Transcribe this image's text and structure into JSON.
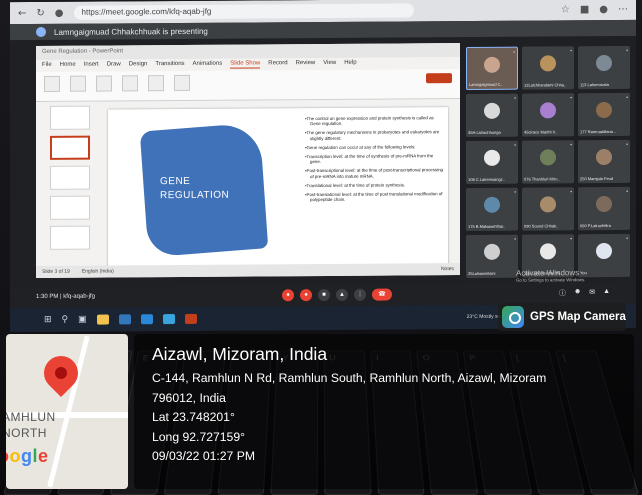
{
  "browser": {
    "url": "https://meet.google.com/kfq-aqab-jfg",
    "nav_icons": [
      "back-icon",
      "reload-icon",
      "lock-icon"
    ]
  },
  "meet": {
    "presenting_banner": "Lamngaigmuad Chhakchhuak is presenting",
    "meeting_info": "1:30 PM | kfq-aqab-jfg",
    "controls": [
      "mic-off-icon",
      "camera-off-icon",
      "captions-icon",
      "present-icon",
      "more-icon",
      "hang-up-icon"
    ],
    "participants": [
      {
        "name": "Lamngaigmuad C..",
        "speaker": true,
        "color": "#c9a48e"
      },
      {
        "name": "12Lalchhandami Chha..",
        "speaker": false,
        "color": "#b9925c"
      },
      {
        "name": "113 Lalremruata",
        "speaker": false,
        "color": "#7d8a96"
      },
      {
        "name": "35H.Lalrachhunga",
        "speaker": false,
        "color": "#d9d9d9"
      },
      {
        "name": "45Grace Marthi V..",
        "speaker": false,
        "color": "#a97fd0"
      },
      {
        "name": "177 Ramruatdiana ..",
        "speaker": false,
        "color": "#8b6b4a"
      },
      {
        "name": "108 C.Lalremsangz..",
        "speaker": false,
        "color": "#e9e9e9"
      },
      {
        "name": "076 Thanhlurl Khin..",
        "speaker": false,
        "color": "#6f7f5a"
      },
      {
        "name": "250 Mamjuia Feud",
        "speaker": false,
        "color": "#9c7f67"
      },
      {
        "name": "175 B.Malsawmthar..",
        "speaker": false,
        "color": "#5f89a8"
      },
      {
        "name": "090 Sound Chhak..",
        "speaker": false,
        "color": "#a88b6a"
      },
      {
        "name": "060 P.Lalrunfelira",
        "speaker": false,
        "color": "#7c6b5c"
      },
      {
        "name": "25Lalsawmkimi",
        "speaker": false,
        "color": "#cfcfcf"
      },
      {
        "name": "115 Lalremsiama Va..",
        "speaker": false,
        "color": "#e8e8e8"
      },
      {
        "name": "You",
        "speaker": false,
        "color": "#dfe6f0"
      }
    ],
    "activate_title": "Activate Windows",
    "activate_sub": "Go to Settings to activate Windows."
  },
  "presentation": {
    "title_bar": "Gene Regulation - PowerPoint",
    "tabs": [
      "File",
      "Home",
      "Insert",
      "Draw",
      "Design",
      "Transitions",
      "Animations",
      "Slide Show",
      "Record",
      "Review",
      "View",
      "Help"
    ],
    "active_tab": "Slide Show",
    "slide_heading_line1": "GENE",
    "slide_heading_line2": "REGULATION",
    "bullets": [
      "The control on gene expression and protein synthesis is called as Gene regulation.",
      "The gene regulatory mechanisms in prokaryotes and eukaryotes are slightly different.",
      "Gene regulation can occur at any of the following levels:",
      "Transcription level: at the time of synthesis of pre-mRNA from the gene.",
      "Post-transcriptional level: at the time of post-transcriptional processing of pre-mRNA into mature mRNA.",
      "Translational level: at the time of protein synthesis.",
      "Post-translational level: at the time of post translational modification of polypeptide chain."
    ],
    "notes_placeholder": "Click to add notes",
    "status_left": "Slide 3 of 19",
    "status_language": "English (India)",
    "status_right": "Notes"
  },
  "taskbar": {
    "weather": "23°C Mostly sunny"
  },
  "keyboard_keys": [
    "Q",
    "W",
    "E",
    "R",
    "T",
    "Y",
    "U",
    "I",
    "O",
    "P",
    "[",
    "]"
  ],
  "gps": {
    "badge_label": "GPS Map Camera",
    "map_label_line1": "AMHLUN",
    "map_label_line2": "NORTH",
    "city": "Aizawl, Mizoram, India",
    "address_line1": "C-144, Ramhlun N Rd, Ramhlun South, Ramhlun North, Aizawl, Mizoram",
    "address_line2": "796012, India",
    "lat": "Lat 23.748201°",
    "long": "Long 92.727159°",
    "datetime": "09/03/22 01:27 PM"
  }
}
